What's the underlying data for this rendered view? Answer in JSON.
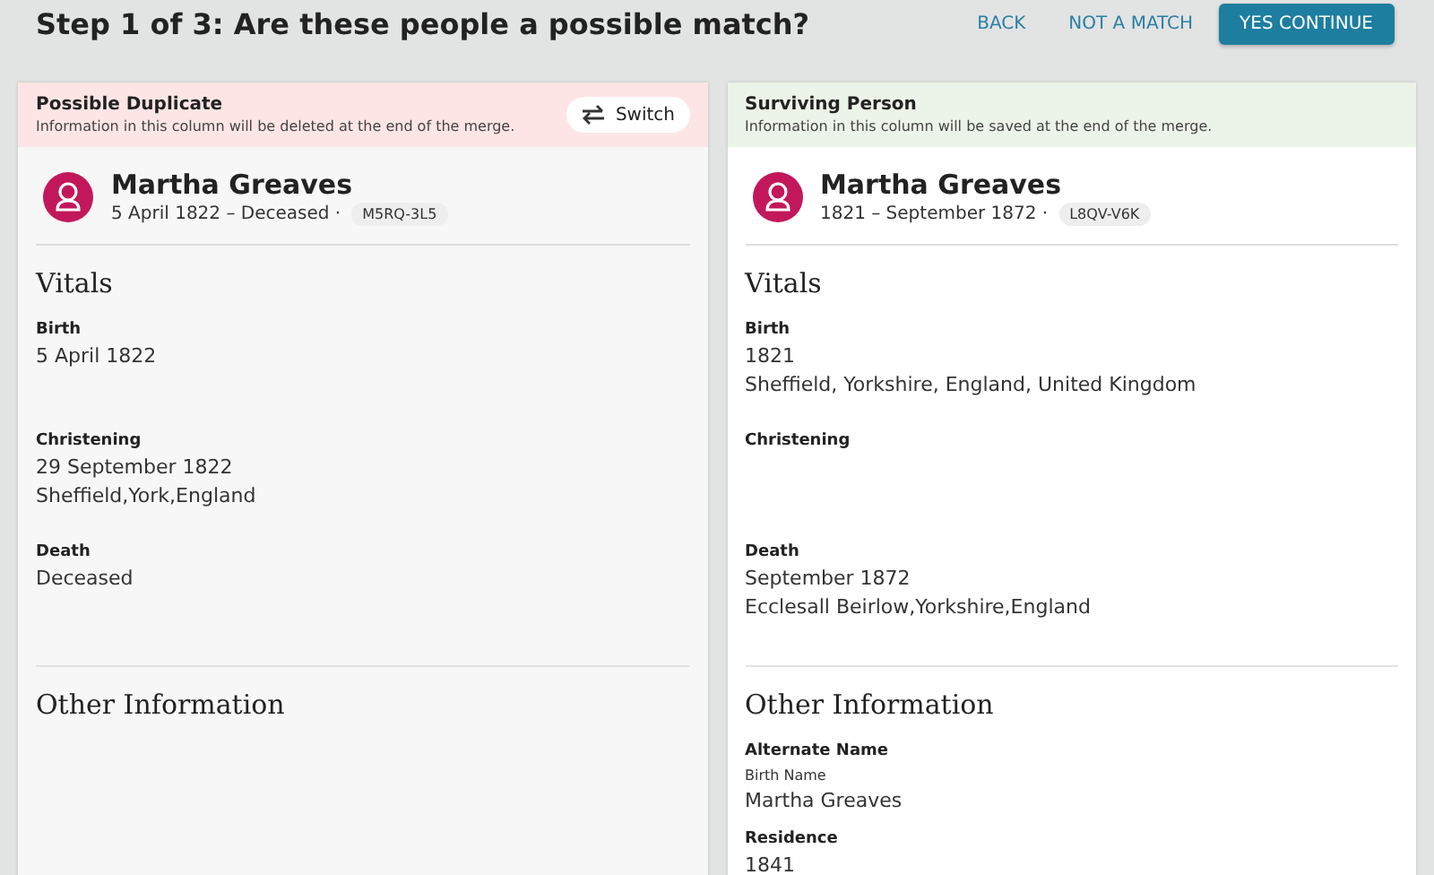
{
  "header": {
    "title": "Step 1 of 3: Are these people a possible match?",
    "buttons": [
      {
        "label": "BACK",
        "kind": "link"
      },
      {
        "label": "NOT A MATCH",
        "kind": "link"
      },
      {
        "label": "YES CONTINUE",
        "kind": "primary"
      }
    ]
  },
  "columns": [
    {
      "kind": "delete",
      "banner_title": "Possible Duplicate",
      "banner_note": "Information in this column will be deleted at the end of the merge.",
      "switch_label": "Switch",
      "name": "Martha Greaves",
      "lifespan": "5 April 1822 – Deceased ·",
      "pid": "M5RQ-3L5",
      "vitals_heading": "Vitals",
      "vitals": [
        {
          "label": "Birth",
          "lines": [
            "5 April 1822"
          ]
        },
        {
          "label": "Christening",
          "lines": [
            "29 September 1822",
            "Sheffield,York,England"
          ]
        },
        {
          "label": "Death",
          "lines": [
            "Deceased"
          ]
        }
      ],
      "other_heading": "Other Information"
    },
    {
      "kind": "save",
      "banner_title": "Surviving Person",
      "banner_note": "Information in this column will be saved at the end of the merge.",
      "name": "Martha Greaves",
      "lifespan": "1821 – September 1872 ·",
      "pid": "L8QV-V6K",
      "vitals_heading": "Vitals",
      "vitals": [
        {
          "label": "Birth",
          "lines": [
            "1821",
            "Sheffield, Yorkshire, England, United Kingdom"
          ]
        },
        {
          "label": "Christening"
        },
        {
          "label": "Death",
          "lines": [
            "September 1872",
            "Ecclesall Beirlow,Yorkshire,England"
          ]
        }
      ],
      "other_heading": "Other Information",
      "other": [
        {
          "label": "Alternate Name",
          "sublabel": "Birth Name",
          "lines": [
            "Martha Greaves"
          ]
        },
        {
          "label": "Residence",
          "lines": [
            "1841"
          ]
        }
      ]
    }
  ]
}
